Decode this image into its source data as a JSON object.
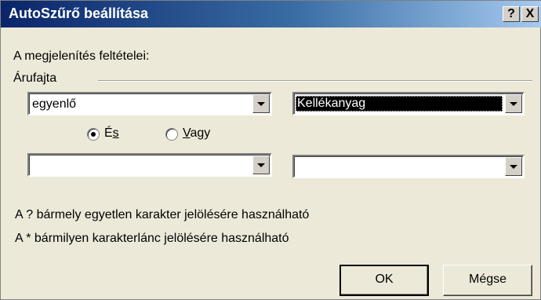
{
  "window": {
    "title": "AutoSzűrő beállítása",
    "help_label": "?",
    "close_label": "X"
  },
  "conditions_label": "A megjelenítés feltételei:",
  "field_name": "Árufajta",
  "row1": {
    "operator": "egyenlő",
    "value": "Kellékanyag"
  },
  "logic": {
    "and_label": "És",
    "and_prefix": "É",
    "and_accel": "s",
    "or_label": "Vagy",
    "or_accel": "V",
    "or_suffix": "agy",
    "selected": "and"
  },
  "row2": {
    "operator": "",
    "value": ""
  },
  "hints": [
    "A ? bármely egyetlen karakter jelölésére használható",
    "A * bármilyen karakterlánc jelölésére használható"
  ],
  "buttons": {
    "ok": "OK",
    "cancel": "Mégse"
  },
  "colors": {
    "title_start": "#0a246a",
    "title_end": "#a6caf0",
    "dialog_bg": "#ece9d8",
    "selection_bg": "#000000"
  },
  "icons": {
    "dropdown": "chevron-down-icon",
    "help": "help-icon",
    "close": "close-icon"
  }
}
